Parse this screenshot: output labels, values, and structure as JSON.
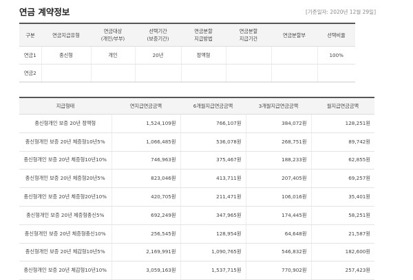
{
  "header": {
    "title": "연금 계약정보",
    "base_date": "[기준일자: 2020년 12월 29일]"
  },
  "contract_table": {
    "headers": [
      {
        "line1": "구분",
        "line2": ""
      },
      {
        "line1": "연금지급유형",
        "line2": ""
      },
      {
        "line1": "연금대상",
        "line2": "(개인/부부)"
      },
      {
        "line1": "선택기간",
        "line2": "(보증기간)"
      },
      {
        "line1": "연금분할",
        "line2": "지급방법"
      },
      {
        "line1": "연금분할",
        "line2": "지급기간"
      },
      {
        "line1": "연금분할부",
        "line2": ""
      },
      {
        "line1": "선택비율",
        "line2": ""
      }
    ],
    "rows": [
      [
        "연금1",
        "종신형",
        "개인",
        "20년",
        "정액형",
        "",
        "",
        "100%"
      ],
      [
        "연금2",
        "",
        "",
        "",
        "",
        "",
        "",
        ""
      ]
    ]
  },
  "payout_table": {
    "headers": [
      "지급형태",
      "연지급연금금액",
      "6개월지급연금금액",
      "3개월지급연금금액",
      "월지급연금금액"
    ],
    "rows": [
      [
        "종신형개인 보증 20년 정액형",
        "1,524,109원",
        "766,107원",
        "384,072원",
        "128,251원"
      ],
      [
        "종신형개인 보증 20년 체증형10년5%",
        "1,066,485원",
        "536,078원",
        "268,751원",
        "89,742원"
      ],
      [
        "종신형개인 보증 20년 체증형10년10%",
        "746,963원",
        "375,467원",
        "188,233원",
        "62,855원"
      ],
      [
        "종신형개인 보증 20년 체증형20년5%",
        "823,046원",
        "413,711원",
        "207,405원",
        "69,257원"
      ],
      [
        "종신형개인 보증 20년 체증형20년10%",
        "420,705원",
        "211,471원",
        "106,016원",
        "35,401원"
      ],
      [
        "종신형개인 보증 20년 체증형종신5%",
        "692,249원",
        "347,965원",
        "174,445원",
        "58,251원"
      ],
      [
        "종신형개인 보증 20년 체증형종신10%",
        "256,545원",
        "128,954원",
        "64,648원",
        "21,587원"
      ],
      [
        "종신형개인 보증 20년 체감형10년5%",
        "2,169,991원",
        "1,090,765원",
        "546,832원",
        "182,600원"
      ],
      [
        "종신형개인 보증 20년 체감형10년10%",
        "3,059,163원",
        "1,537,715원",
        "770,902원",
        "257,423원"
      ]
    ]
  }
}
